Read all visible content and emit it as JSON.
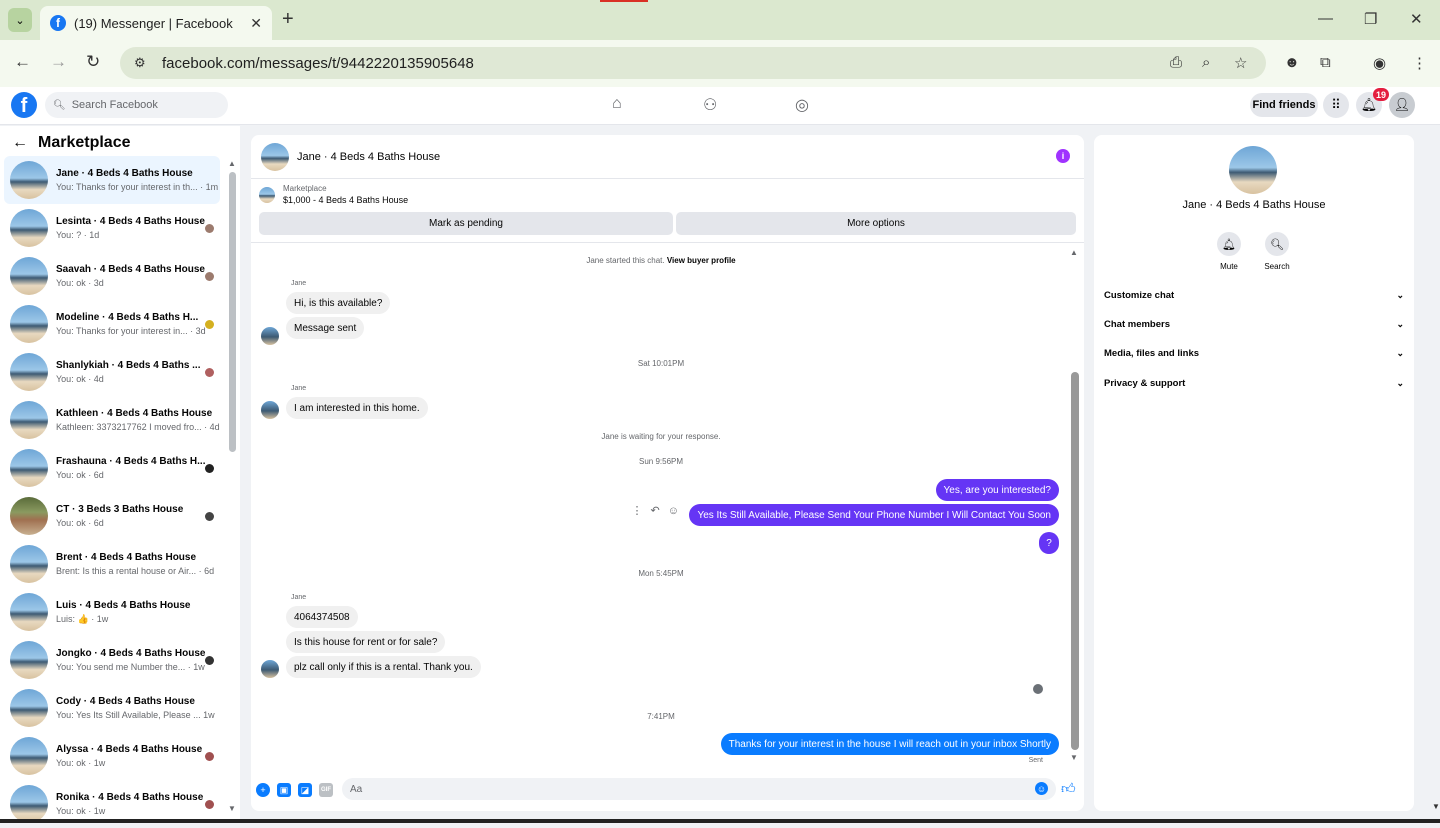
{
  "browser": {
    "tab_title": "(19) Messenger | Facebook",
    "url": "facebook.com/messages/t/9442220135905648"
  },
  "fb": {
    "search_placeholder": "Search Facebook",
    "find_friends": "Find friends",
    "notif_count": "19"
  },
  "sidebar": {
    "title": "Marketplace",
    "conversations": [
      {
        "name": "Jane · 4 Beds 4 Baths House",
        "preview": "You: Thanks for your interest in th...  · 1m"
      },
      {
        "name": "Lesinta · 4 Beds 4 Baths House",
        "preview": "You: ? · 1d"
      },
      {
        "name": "Saavah · 4 Beds 4 Baths House",
        "preview": "You: ok · 3d"
      },
      {
        "name": "Modeline · 4 Beds 4 Baths H...",
        "preview": "You: Thanks for your interest in...  · 3d"
      },
      {
        "name": "Shanlykiah · 4 Beds 4 Baths ...",
        "preview": "You: ok · 4d"
      },
      {
        "name": "Kathleen · 4 Beds 4 Baths House",
        "preview": "Kathleen: 3373217762 I moved fro...  · 4d"
      },
      {
        "name": "Frashauna · 4 Beds 4 Baths H...",
        "preview": "You: ok · 6d"
      },
      {
        "name": "CT · 3 Beds 3 Baths House",
        "preview": "You: ok · 6d"
      },
      {
        "name": "Brent · 4 Beds 4 Baths House",
        "preview": "Brent: Is this a rental house or Air...  · 6d"
      },
      {
        "name": "Luis · 4 Beds 4 Baths House",
        "preview": "Luis: 👍 · 1w"
      },
      {
        "name": "Jongko · 4 Beds 4 Baths House",
        "preview": "You: You send me Number the...  · 1w"
      },
      {
        "name": "Cody · 4 Beds 4 Baths House",
        "preview": "You: Yes Its Still Available, Please ...  1w"
      },
      {
        "name": "Alyssa · 4 Beds 4 Baths House",
        "preview": "You: ok · 1w"
      },
      {
        "name": "Ronika · 4 Beds 4 Baths House",
        "preview": "You: ok · 1w"
      }
    ]
  },
  "chat": {
    "title": "Jane · 4 Beds 4 Baths House",
    "marketplace_label": "Marketplace",
    "listing": "$1,000 - 4 Beds 4 Baths House",
    "mark_pending": "Mark as pending",
    "more_options": "More options",
    "started_text": "Jane started this chat.",
    "view_buyer": "View buyer profile",
    "sender": "Jane",
    "messages": {
      "m1": "Hi, is this available?",
      "m2": "Message sent",
      "ts1": "Sat 10:01PM",
      "m3": "I am interested in this home.",
      "waiting": "Jane is waiting for your response.",
      "ts2": "Sun 9:56PM",
      "o1": "Yes, are you interested?",
      "o2": "Yes Its Still Available, Please Send Your Phone Number I Will Contact You Soon",
      "o3": "?",
      "ts3": "Mon 5:45PM",
      "m4": "4064374508",
      "m5": "Is this house for rent or for sale?",
      "m6": "plz call only if this is a rental. Thank you.",
      "ts4": "7:41PM",
      "o4": "Thanks for your interest in the house I will reach out in your inbox Shortly",
      "sent": "Sent"
    },
    "composer_placeholder": "Aa"
  },
  "rpanel": {
    "name": "Jane · 4 Beds 4 Baths House",
    "mute": "Mute",
    "search": "Search",
    "items": [
      "Customize chat",
      "Chat members",
      "Media, files and links",
      "Privacy & support"
    ]
  }
}
